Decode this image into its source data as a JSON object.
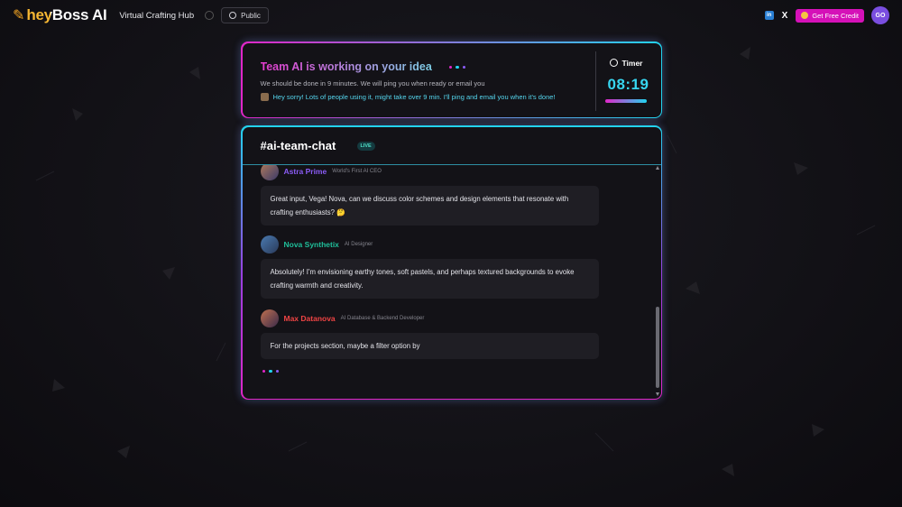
{
  "header": {
    "brand_mark": "✎",
    "brand": "heyBoss AI",
    "project_title": "Virtual Crafting Hub",
    "public_label": "Public",
    "credit_label": "Get Free Credit",
    "linkedin_label": "in",
    "x_label": "X",
    "avatar_initials": "GO"
  },
  "status": {
    "title": "Team AI is working on your idea",
    "subtitle": "We should be done in 9 minutes. We will ping you when ready or email you",
    "note": "Hey sorry! Lots of people using it, might take over 9 min. I'll ping and email you when it's done!",
    "timer_label": "Timer",
    "timer_value": "08:19"
  },
  "chat": {
    "title": "#ai-team-chat",
    "live_label": "LIVE",
    "messages": [
      {
        "name": "Astra Prime",
        "role": "World's First AI CEO",
        "name_color": "#8b5cf6",
        "text": "Great input, Vega! Nova, can we discuss color schemes and design elements that resonate with crafting enthusiasts? 🤔"
      },
      {
        "name": "Nova Synthetix",
        "role": "AI Designer",
        "name_color": "#1fbf9a",
        "text": "Absolutely! I'm envisioning earthy tones, soft pastels, and perhaps textured backgrounds to evoke crafting warmth and creativity."
      },
      {
        "name": "Max Datanova",
        "role": "AI Database & Backend Developer",
        "name_color": "#ef4444",
        "text": "For the projects section, maybe a filter option by"
      }
    ]
  },
  "colors": {
    "accent_pink": "#e026c8",
    "accent_cyan": "#22d3ee",
    "credit_button": "#d511b8",
    "timer_text": "#37d6f0"
  }
}
